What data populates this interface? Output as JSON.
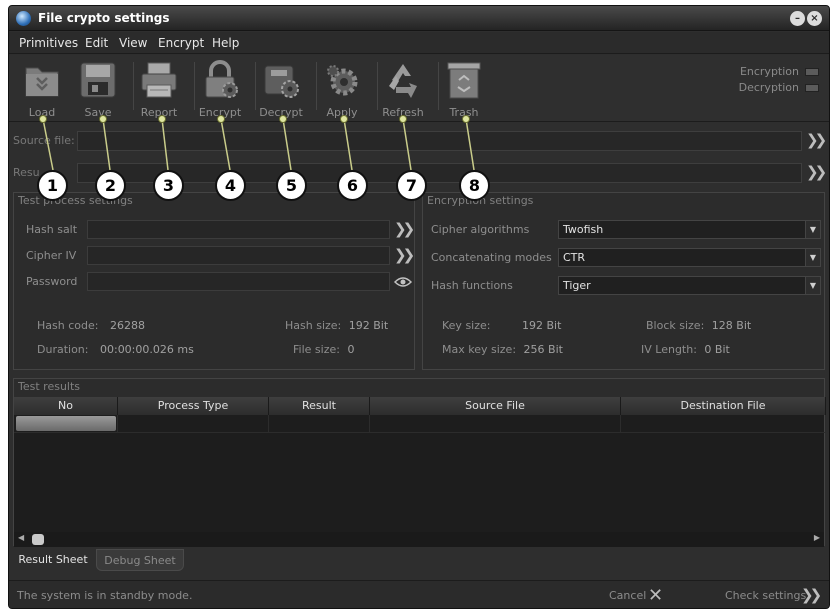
{
  "window": {
    "title": "File crypto settings"
  },
  "menu": [
    "Primitives",
    "Edit",
    "View",
    "Encrypt",
    "Help"
  ],
  "toolbar": {
    "buttons": [
      {
        "label": "Load",
        "icon": "folder-icon"
      },
      {
        "label": "Save",
        "icon": "floppy-disk-icon"
      },
      {
        "label": "Report",
        "icon": "printer-icon"
      },
      {
        "label": "Encrypt",
        "icon": "padlock-gear-icon"
      },
      {
        "label": "Decrypt",
        "icon": "unlock-gear-icon"
      },
      {
        "label": "Apply",
        "icon": "gear-icon"
      },
      {
        "label": "Refresh",
        "icon": "recycle-icon"
      },
      {
        "label": "Trash",
        "icon": "trash-icon"
      }
    ],
    "modes": [
      "Encryption",
      "Decryption"
    ]
  },
  "source_file": {
    "label": "Source file:",
    "value": ""
  },
  "result_file": {
    "label": "Resu",
    "value": ""
  },
  "test_process": {
    "title": "Test process settings",
    "hash_salt": {
      "label": "Hash salt",
      "value": ""
    },
    "cipher_iv": {
      "label": "Cipher IV",
      "value": ""
    },
    "password": {
      "label": "Password",
      "value": ""
    },
    "stats": [
      {
        "label": "Hash code:",
        "value": "26288"
      },
      {
        "label": "Hash size:",
        "value": "192 Bit"
      },
      {
        "label": "Duration:",
        "value": "00:00:00.026 ms"
      },
      {
        "label": "File size:",
        "value": "0"
      }
    ]
  },
  "encryption": {
    "title": "Encryption settings",
    "cipher": {
      "label": "Cipher algorithms",
      "value": "Twofish"
    },
    "mode": {
      "label": "Concatenating modes",
      "value": "CTR"
    },
    "hash": {
      "label": "Hash functions",
      "value": "Tiger"
    },
    "stats": [
      {
        "label": "Key size:",
        "value": "192 Bit"
      },
      {
        "label": "Block size:",
        "value": "128 Bit"
      },
      {
        "label": "Max key size:",
        "value": "256 Bit"
      },
      {
        "label": "IV Length:",
        "value": "0 Bit"
      }
    ]
  },
  "results": {
    "title": "Test results",
    "columns": [
      "No",
      "Process Type",
      "Result",
      "Source File",
      "Destination File"
    ]
  },
  "sheets": [
    "Result Sheet",
    "Debug Sheet"
  ],
  "status": {
    "message": "The system is in standby mode.",
    "cancel_label": "Cancel",
    "check_label": "Check settings"
  },
  "callouts": [
    "1",
    "2",
    "3",
    "4",
    "5",
    "6",
    "7",
    "8"
  ],
  "colors": {
    "window_bg": "#2e2e2e",
    "callout_fill": "#ffffff",
    "pin": "#dfe6a0"
  }
}
